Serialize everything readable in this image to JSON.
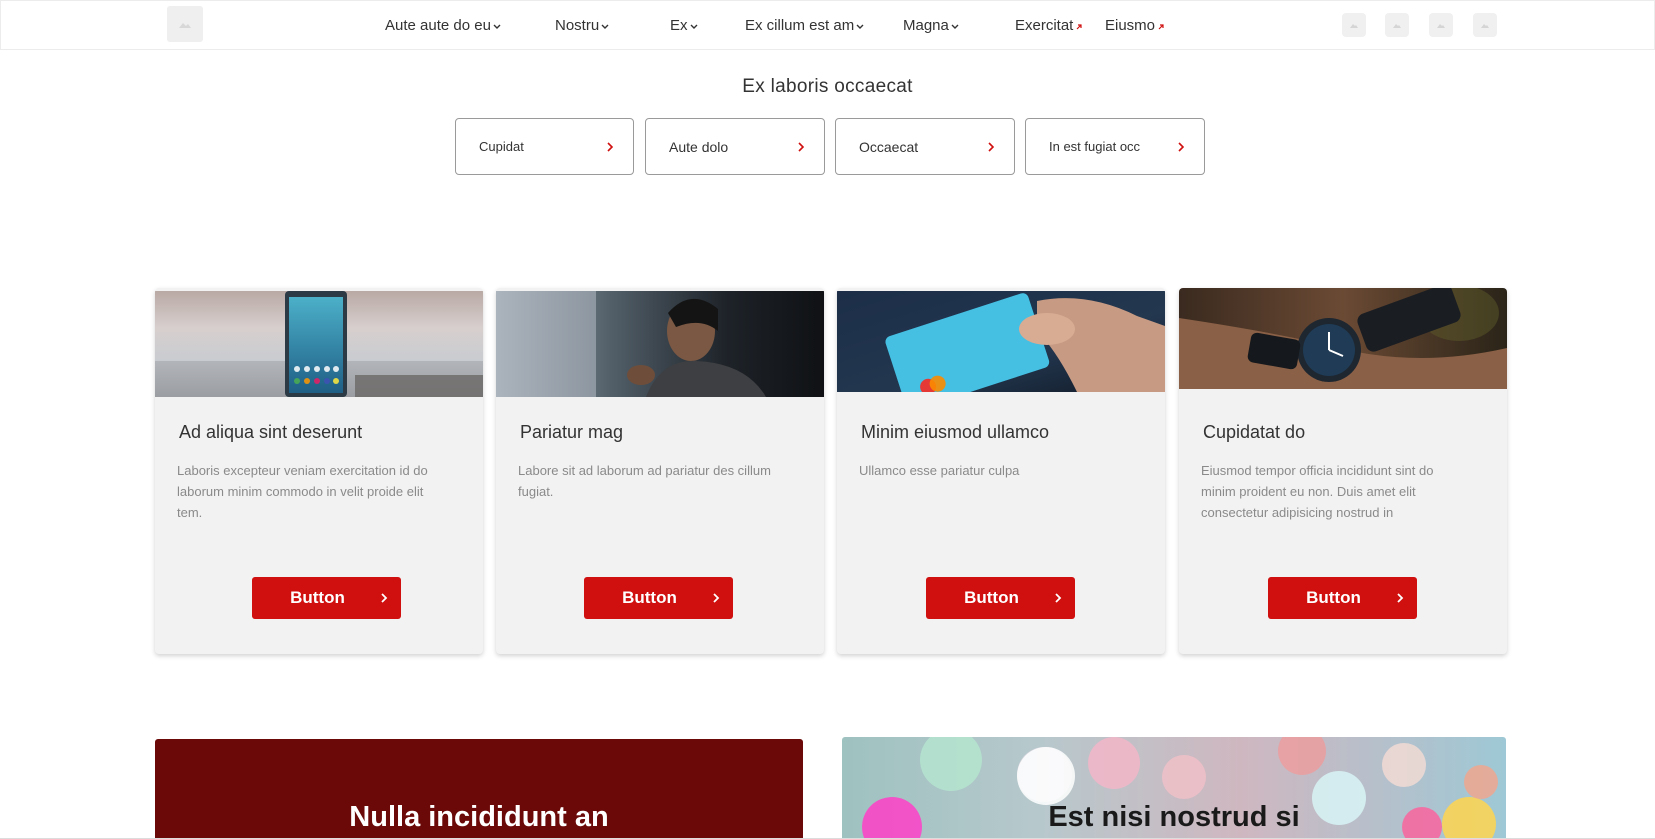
{
  "header": {
    "logo_icon": "image-placeholder-icon",
    "nav": [
      {
        "label": "Aute aute do eu",
        "icon": "chevron-down-icon"
      },
      {
        "label": "Nostru",
        "icon": "chevron-down-icon"
      },
      {
        "label": "Ex",
        "icon": "chevron-down-icon"
      },
      {
        "label": "Ex cillum est am",
        "icon": "chevron-down-icon"
      },
      {
        "label": "Magna",
        "icon": "chevron-down-icon"
      },
      {
        "label": "Exercitat",
        "icon": "external-link-icon"
      },
      {
        "label": "Eiusmo",
        "icon": "external-link-icon"
      }
    ],
    "right_icons": [
      "image-placeholder-icon",
      "image-placeholder-icon",
      "image-placeholder-icon",
      "image-placeholder-icon"
    ]
  },
  "subheading": "Ex laboris occaecat",
  "quick_links": [
    {
      "label": "Cupidat"
    },
    {
      "label": "Aute dolo"
    },
    {
      "label": "Occaecat"
    },
    {
      "label": "In est fugiat occ"
    }
  ],
  "cards": [
    {
      "image": "smartphone-photo",
      "title": "Ad aliqua sint deserunt",
      "description": "Laboris excepteur veniam exercitation id do laborum minim commodo in velit proide elit tem.",
      "button": "Button"
    },
    {
      "image": "person-profile-photo",
      "title": "Pariatur mag",
      "description": "Labore sit ad laborum ad pariatur des cillum fugiat.",
      "button": "Button"
    },
    {
      "image": "credit-card-photo",
      "title": "Minim eiusmod ullamco",
      "description": "Ullamco esse pariatur culpa",
      "button": "Button"
    },
    {
      "image": "wristwatch-photo",
      "title": "Cupidatat do",
      "description": "Eiusmod tempor officia incididunt sint do minim proident eu non. Duis amet elit consectetur adipisicing nostrud in",
      "button": "Button"
    }
  ],
  "promos": {
    "left": {
      "title": "Nulla incididunt an"
    },
    "right": {
      "title": "Est nisi nostrud si",
      "image": "bokeh-lights-background"
    }
  },
  "colors": {
    "accent": "#d00f0f",
    "promo_dark": "#6b0808",
    "card_bg": "#f2f2f2",
    "muted_text": "#8a8a8a"
  }
}
